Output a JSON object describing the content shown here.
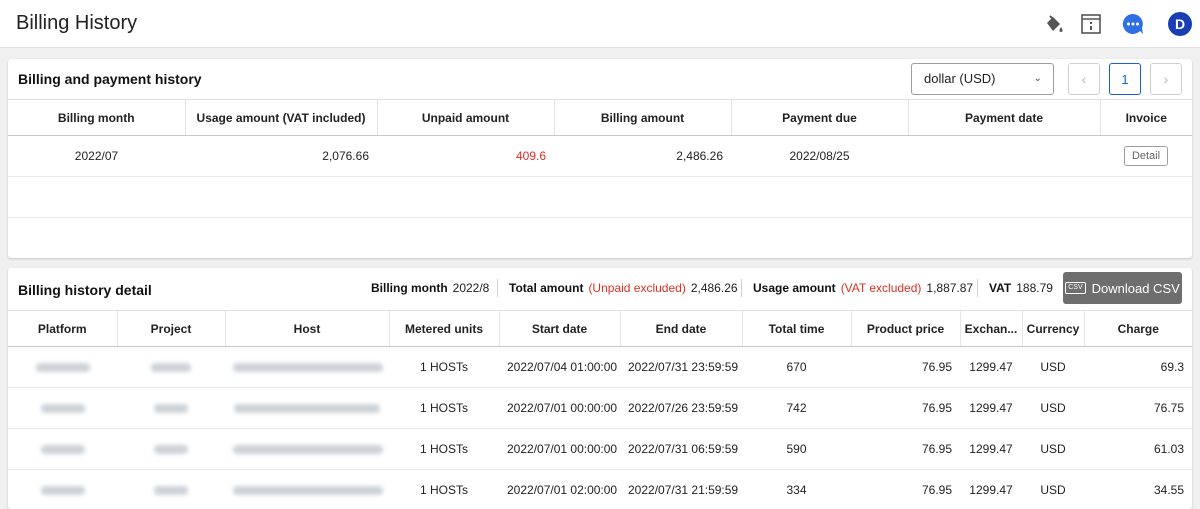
{
  "header": {
    "title": "Billing History",
    "user_initial": "D"
  },
  "payment_history": {
    "title": "Billing and payment history",
    "currency_select": "dollar (USD)",
    "current_page": "1",
    "columns": [
      "Billing month",
      "Usage amount (VAT included)",
      "Unpaid amount",
      "Billing amount",
      "Payment due",
      "Payment date",
      "Invoice"
    ],
    "rows": [
      {
        "billing_month": "2022/07",
        "usage_amount": "2,076.66",
        "unpaid_amount": "409.6",
        "billing_amount": "2,486.26",
        "payment_due": "2022/08/25",
        "payment_date": "",
        "invoice": "Detail"
      }
    ]
  },
  "billing_detail": {
    "title": "Billing history detail",
    "summary": {
      "billing_month_label": "Billing month",
      "billing_month": "2022/8",
      "total_label": "Total amount",
      "total_note": "(Unpaid excluded)",
      "total": "2,486.26",
      "usage_label": "Usage amount",
      "usage_note": "(VAT excluded)",
      "usage": "1,887.87",
      "vat_label": "VAT",
      "vat": "188.79"
    },
    "download_button": "Download CSV",
    "columns": [
      "Platform",
      "Project",
      "Host",
      "Metered units",
      "Start date",
      "End date",
      "Total time",
      "Product price",
      "Exchan...",
      "Currency",
      "Charge"
    ],
    "rows": [
      {
        "metered_units": "1 HOSTs",
        "start_date": "2022/07/04 01:00:00",
        "end_date": "2022/07/31 23:59:59",
        "total_time": "670",
        "product_price": "76.95",
        "exchange": "1299.47",
        "currency": "USD",
        "charge": "69.3"
      },
      {
        "metered_units": "1 HOSTs",
        "start_date": "2022/07/01 00:00:00",
        "end_date": "2022/07/26 23:59:59",
        "total_time": "742",
        "product_price": "76.95",
        "exchange": "1299.47",
        "currency": "USD",
        "charge": "76.75"
      },
      {
        "metered_units": "1 HOSTs",
        "start_date": "2022/07/01 00:00:00",
        "end_date": "2022/07/31 06:59:59",
        "total_time": "590",
        "product_price": "76.95",
        "exchange": "1299.47",
        "currency": "USD",
        "charge": "61.03"
      },
      {
        "metered_units": "1 HOSTs",
        "start_date": "2022/07/01 02:00:00",
        "end_date": "2022/07/31 21:59:59",
        "total_time": "334",
        "product_price": "76.95",
        "exchange": "1299.47",
        "currency": "USD",
        "charge": "34.55"
      }
    ]
  },
  "colors": {
    "accent": "#1a5fd6",
    "avatar": "#1a3fb5",
    "chat_icon": "#2f6fe4",
    "negative": "#d93025",
    "csv_button": "#6e6e6e"
  },
  "icons": [
    "paint-bucket-icon",
    "notice-icon",
    "chat-icon",
    "chevron-down-icon",
    "chevron-left-icon",
    "chevron-right-icon",
    "csv-icon"
  ]
}
